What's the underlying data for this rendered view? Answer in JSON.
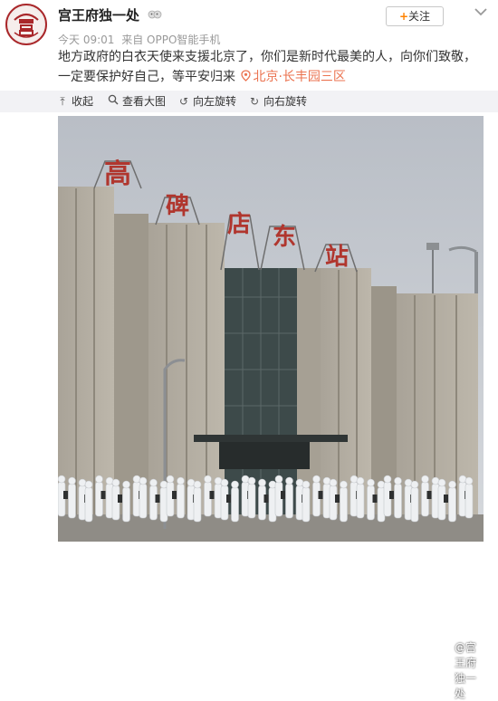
{
  "post": {
    "author": "宫王府独一处",
    "time": "今天 09:01",
    "source": "来自 OPPO智能手机",
    "follow_label": "关注",
    "text": "地方政府的白衣天使来支援北京了，你们是新时代最美的人，向你们致敬，一定要保护好自己，等平安归来",
    "location": "北京·长丰园三区"
  },
  "toolbar": {
    "collapse": "收起",
    "view_large": "查看大图",
    "rotate_left": "向左旋转",
    "rotate_right": "向右旋转"
  },
  "photo": {
    "sign_chars": [
      "高",
      "碑",
      "店",
      "东",
      "站"
    ],
    "watermark": "@宫王府独一处"
  },
  "colors": {
    "accent": "#eb7350",
    "follow_plus": "#ff8200",
    "sign_red": "#b0362e"
  },
  "icons": {
    "verified": "ghost-emoji-icon",
    "more": "chevron-down-icon",
    "collapse": "collapse-icon",
    "view_large": "magnifier-icon",
    "rotate_left": "rotate-left-icon",
    "rotate_right": "rotate-right-icon",
    "location": "location-pin-icon"
  }
}
